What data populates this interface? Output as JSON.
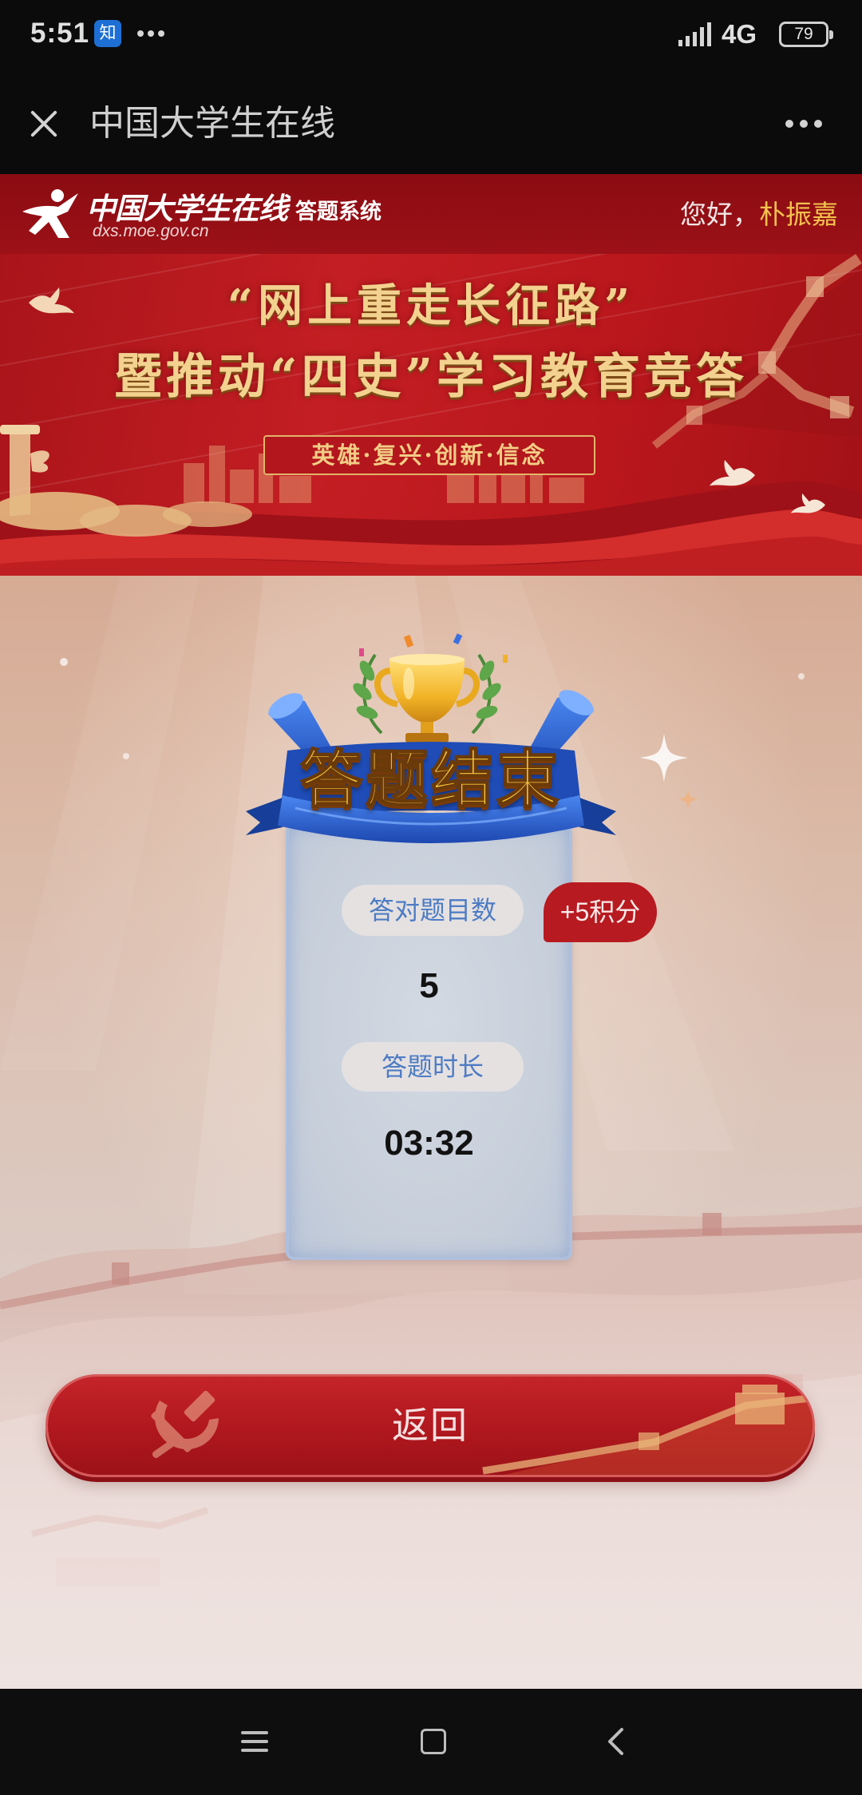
{
  "status_bar": {
    "time": "5:51",
    "app_badge": "知",
    "network": "4G",
    "battery": "79",
    "icons": [
      "notification-more-icon",
      "signal-icon",
      "battery-icon"
    ]
  },
  "title_bar": {
    "title": "中国大学生在线",
    "icons": [
      "close-icon",
      "more-dots-icon"
    ]
  },
  "header": {
    "logo_name": "中国大学生在线",
    "logo_system": "答题系统",
    "logo_url": "dxs.moe.gov.cn",
    "greeting": "您好，",
    "username": "朴振嘉"
  },
  "banner": {
    "line1": "“网上重走长征路”",
    "line2": "暨推动“四史”学习教育竞答",
    "motto": "英雄·复兴·创新·信念"
  },
  "result": {
    "title": "答题结束",
    "correct_label": "答对题目数",
    "correct_count": "5",
    "points_badge": "+5积分",
    "duration_label": "答题时长",
    "duration": "03:32"
  },
  "actions": {
    "back_label": "返回"
  },
  "nav_bar": {
    "icons": [
      "menu-icon",
      "home-square-icon",
      "back-chevron-icon"
    ]
  },
  "colors": {
    "brand_red": "#a8141b",
    "gold": "#f0c04a",
    "username": "#f3c24d",
    "card_bg": "#c8d0dc",
    "pill_text": "#4d7cc4",
    "badge_red": "#b71a20"
  }
}
